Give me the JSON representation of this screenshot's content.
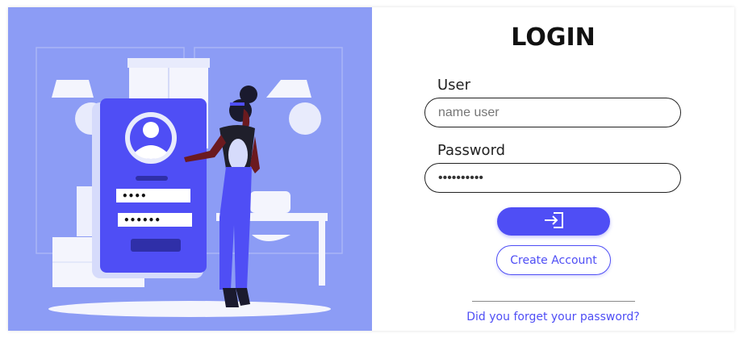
{
  "illustration": {
    "name": "login-illustration",
    "background": "#8c9cf5",
    "accent": "#4f4ef5",
    "pin_dots": "••••",
    "password_dots": "••••••"
  },
  "form": {
    "title": "LOGIN",
    "user": {
      "label": "User",
      "placeholder": "name user",
      "value": ""
    },
    "password": {
      "label": "Password",
      "value": "••••••••••"
    },
    "login_button": {
      "icon": "sign-in-icon",
      "color": "#4f4ef5"
    },
    "create_account_label": "Create Account",
    "forgot_link": "Did you forget your password?"
  }
}
